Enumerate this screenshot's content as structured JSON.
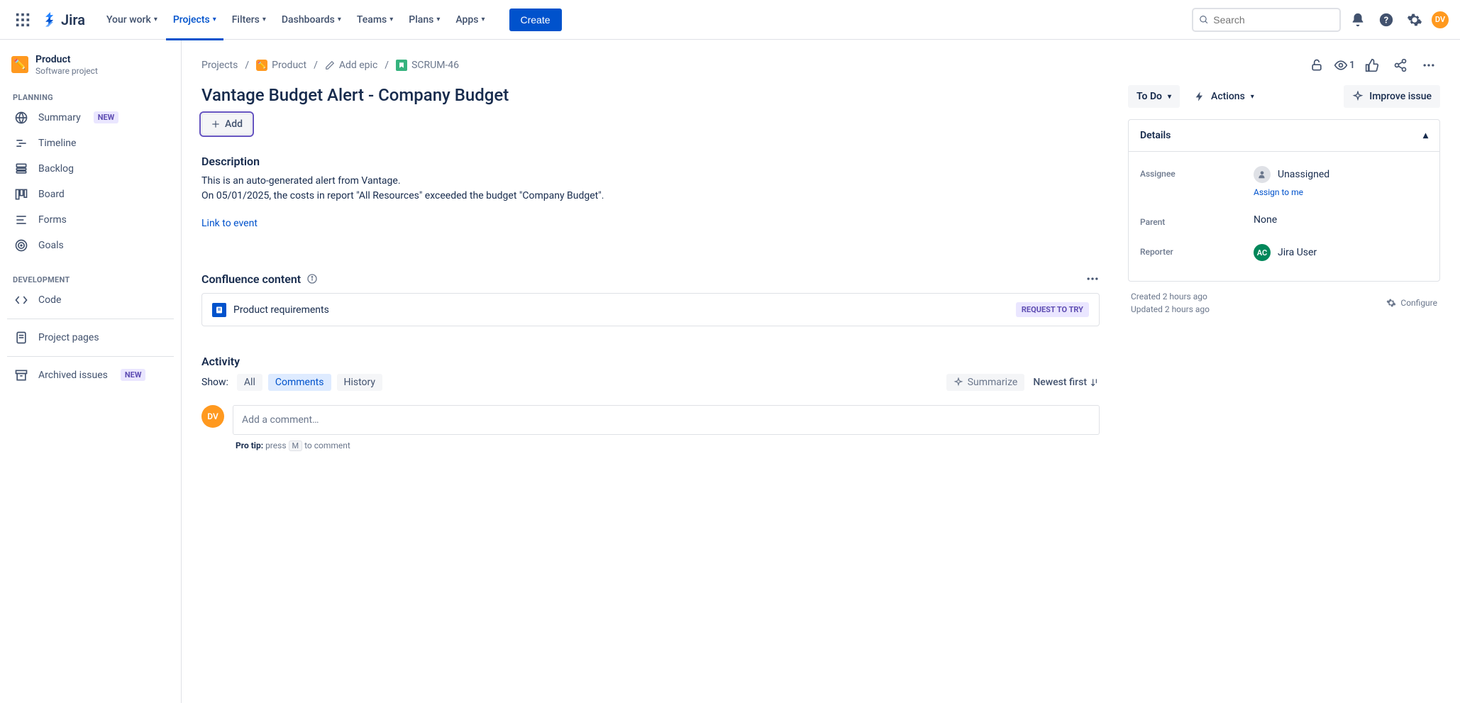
{
  "topnav": {
    "logo_text": "Jira",
    "items": [
      "Your work",
      "Projects",
      "Filters",
      "Dashboards",
      "Teams",
      "Plans",
      "Apps"
    ],
    "active_index": 1,
    "create_label": "Create",
    "search_placeholder": "Search",
    "avatar_initials": "DV"
  },
  "sidebar": {
    "project_name": "Product",
    "project_type": "Software project",
    "section_planning": "PLANNING",
    "section_development": "DEVELOPMENT",
    "planning_items": [
      {
        "label": "Summary",
        "badge": "NEW"
      },
      {
        "label": "Timeline"
      },
      {
        "label": "Backlog"
      },
      {
        "label": "Board"
      },
      {
        "label": "Forms"
      },
      {
        "label": "Goals"
      }
    ],
    "dev_items": [
      {
        "label": "Code"
      }
    ],
    "bottom_items": [
      {
        "label": "Project pages"
      },
      {
        "label": "Archived issues",
        "badge": "NEW"
      }
    ]
  },
  "breadcrumb": {
    "root": "Projects",
    "project": "Product",
    "add_epic": "Add epic",
    "issue_key": "SCRUM-46",
    "watch_count": "1"
  },
  "issue": {
    "title": "Vantage Budget Alert - Company Budget",
    "add_label": "Add",
    "description_title": "Description",
    "description_line1": "This is an auto-generated alert from Vantage.",
    "description_line2": "On 05/01/2025, the costs in report \"All Resources\" exceeded the budget \"Company Budget\".",
    "link_event": "Link to event"
  },
  "confluence": {
    "title": "Confluence content",
    "doc_name": "Product requirements",
    "badge": "REQUEST TO TRY"
  },
  "activity": {
    "title": "Activity",
    "show_label": "Show:",
    "tabs": [
      "All",
      "Comments",
      "History"
    ],
    "active_tab": 1,
    "summarize": "Summarize",
    "sort": "Newest first",
    "comment_avatar": "DV",
    "comment_placeholder": "Add a comment…",
    "protip_label": "Pro tip:",
    "protip_before": "press",
    "protip_key": "M",
    "protip_after": "to comment"
  },
  "right": {
    "status": "To Do",
    "actions": "Actions",
    "improve": "Improve issue",
    "details_title": "Details",
    "assignee_label": "Assignee",
    "assignee_value": "Unassigned",
    "assign_to_me": "Assign to me",
    "parent_label": "Parent",
    "parent_value": "None",
    "reporter_label": "Reporter",
    "reporter_value": "Jira User",
    "reporter_initials": "AC",
    "created": "Created 2 hours ago",
    "updated": "Updated 2 hours ago",
    "configure": "Configure"
  }
}
